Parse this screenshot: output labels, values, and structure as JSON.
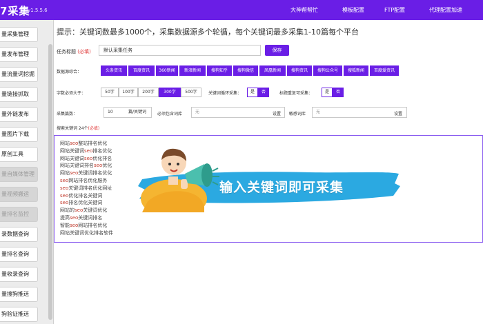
{
  "header": {
    "logo": "7采集",
    "version": "v1.5.5.6",
    "nav": [
      "大神帮帮忙",
      "模板配置",
      "FTP配置",
      "代理配置加速"
    ]
  },
  "sidebar": {
    "items": [
      {
        "label": "量采集管理",
        "disabled": false
      },
      {
        "label": "量发布管理",
        "disabled": false
      },
      {
        "label": "量流量词挖掘",
        "disabled": false
      },
      {
        "label": "量链接抓取",
        "disabled": false
      },
      {
        "label": "量外链发布",
        "disabled": false
      },
      {
        "label": "量图片下载",
        "disabled": false
      },
      {
        "label": "原创工具",
        "disabled": false
      },
      {
        "label": "量自媒体管理",
        "disabled": true
      },
      {
        "label": "量视频搬运",
        "disabled": true
      },
      {
        "label": "量排名监控",
        "disabled": true
      },
      {
        "label": "录数据查询",
        "disabled": false
      },
      {
        "label": "量排名查询",
        "disabled": false
      },
      {
        "label": "量收录查询",
        "disabled": false
      },
      {
        "label": "量搜狗推送",
        "disabled": false
      },
      {
        "label": "狗验证推送",
        "disabled": false
      }
    ]
  },
  "main": {
    "hint": "提示：关键词数最多1000个，采集数据源多个轮循，每个关键词最多采集1-10篇每个平台",
    "task": {
      "label": "任务标题",
      "required": "(必填)",
      "value": "默认采集任务",
      "save": "保存"
    },
    "sources": {
      "label": "数据源综合：",
      "items": [
        "头条资讯",
        "百度资讯",
        "360新闻",
        "新浪新闻",
        "搜狗知乎",
        "搜狗微信",
        "凤凰新闻",
        "搜狗资讯",
        "搜狗公众号",
        "搜狐新闻",
        "百度爱资讯"
      ]
    },
    "word_count": {
      "label": "字数必须大于：",
      "options": [
        "50字",
        "100字",
        "200字",
        "300字",
        "500字"
      ],
      "selected": "300字"
    },
    "kw_loop": {
      "label": "关键词循环采集：",
      "yes": "是",
      "no": "否",
      "selected": "否"
    },
    "title_repeat": {
      "label": "标题重复可采集：",
      "yes": "是",
      "no": "否",
      "selected": "否"
    },
    "collect_count": {
      "label": "采集篇数：",
      "value": "10",
      "unit": "篇/关键词"
    },
    "must_include": {
      "label": "必须包含词库",
      "value": "无",
      "set": "设置"
    },
    "sensitive": {
      "label": "敏感词库",
      "value": "无",
      "set": "设置"
    },
    "keywords_label": "搜索关键词 24个",
    "keywords_required": "(必填)",
    "keywords": [
      [
        "网站",
        "seo",
        "整站排名优化"
      ],
      [
        "网站关键词",
        "seo",
        "排名优化"
      ],
      [
        "网站关键词",
        "seo",
        "优化排名"
      ],
      [
        "网站关键词排名",
        "seo",
        "优化"
      ],
      [
        "网站",
        "seo",
        "关键词排名优化"
      ],
      [
        "",
        "seo",
        "网站排名优化服务"
      ],
      [
        "",
        "seo",
        "关键词排名优化网址"
      ],
      [
        "",
        "seo",
        "优化排名关键词"
      ],
      [
        "",
        "seo",
        "排名优化关键词"
      ],
      [
        "网站的",
        "seo",
        "关键词优化"
      ],
      [
        "提高",
        "seo",
        "关键词排名"
      ],
      [
        "智能",
        "seo",
        "网站排名优化"
      ],
      [
        "网站关键词优化排名软件",
        "",
        ""
      ]
    ],
    "banner": "输入关键词即可采集"
  },
  "colors": {
    "accent": "#6a1ee6",
    "banner": "#2ba9e1",
    "required": "#e03a3a"
  }
}
